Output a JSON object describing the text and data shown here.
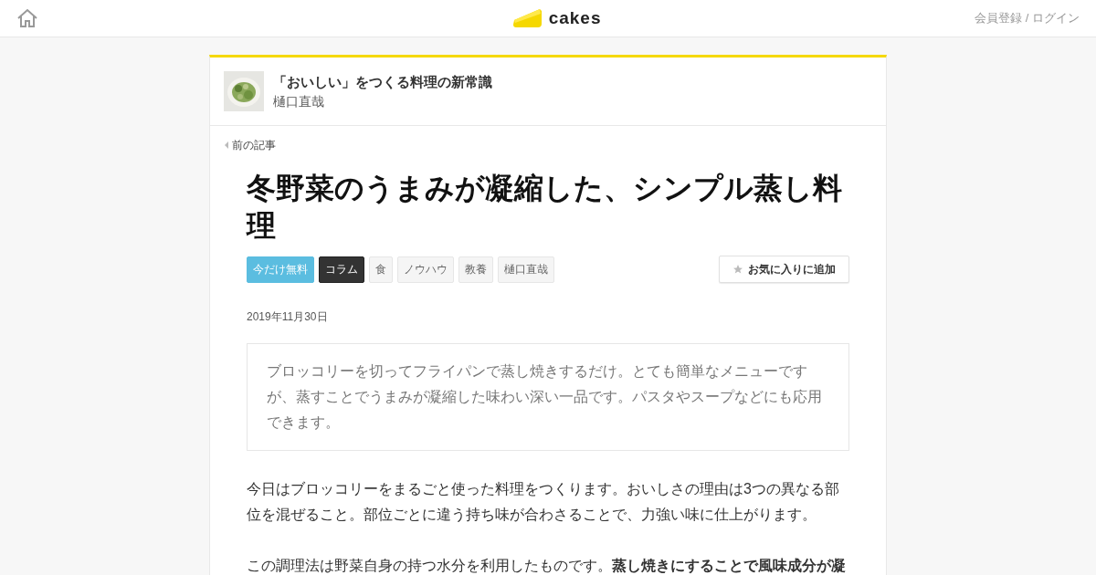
{
  "header": {
    "logo_text": "cakes",
    "auth_link": "会員登録 / ログイン"
  },
  "series": {
    "title": "「おいしい」をつくる料理の新常識",
    "author": "樋口直哉"
  },
  "prev_link": "前の記事",
  "article": {
    "title": "冬野菜のうまみが凝縮した、シンプル蒸し料理",
    "tags": [
      {
        "label": "今だけ無料",
        "kind": "highlight"
      },
      {
        "label": "コラム",
        "kind": "dark"
      },
      {
        "label": "食",
        "kind": "plain"
      },
      {
        "label": "ノウハウ",
        "kind": "plain"
      },
      {
        "label": "教養",
        "kind": "plain"
      },
      {
        "label": "樋口直哉",
        "kind": "plain"
      }
    ],
    "favorite_button": "お気に入りに追加",
    "date": "2019年11月30日",
    "lead": "ブロッコリーを切ってフライパンで蒸し焼きするだけ。とても簡単なメニューですが、蒸すことでうまみが凝縮した味わい深い一品です。パスタやスープなどにも応用できます。",
    "paragraphs": [
      "今日はブロッコリーをまるごと使った料理をつくります。おいしさの理由は3つの異なる部位を混ぜること。部位ごとに違う持ち味が合わさることで、力強い味に仕上がります。",
      "この調理法は野菜自身の持つ水分を利用したものです。**蒸し焼きにすることで風味成分が凝**"
    ]
  }
}
